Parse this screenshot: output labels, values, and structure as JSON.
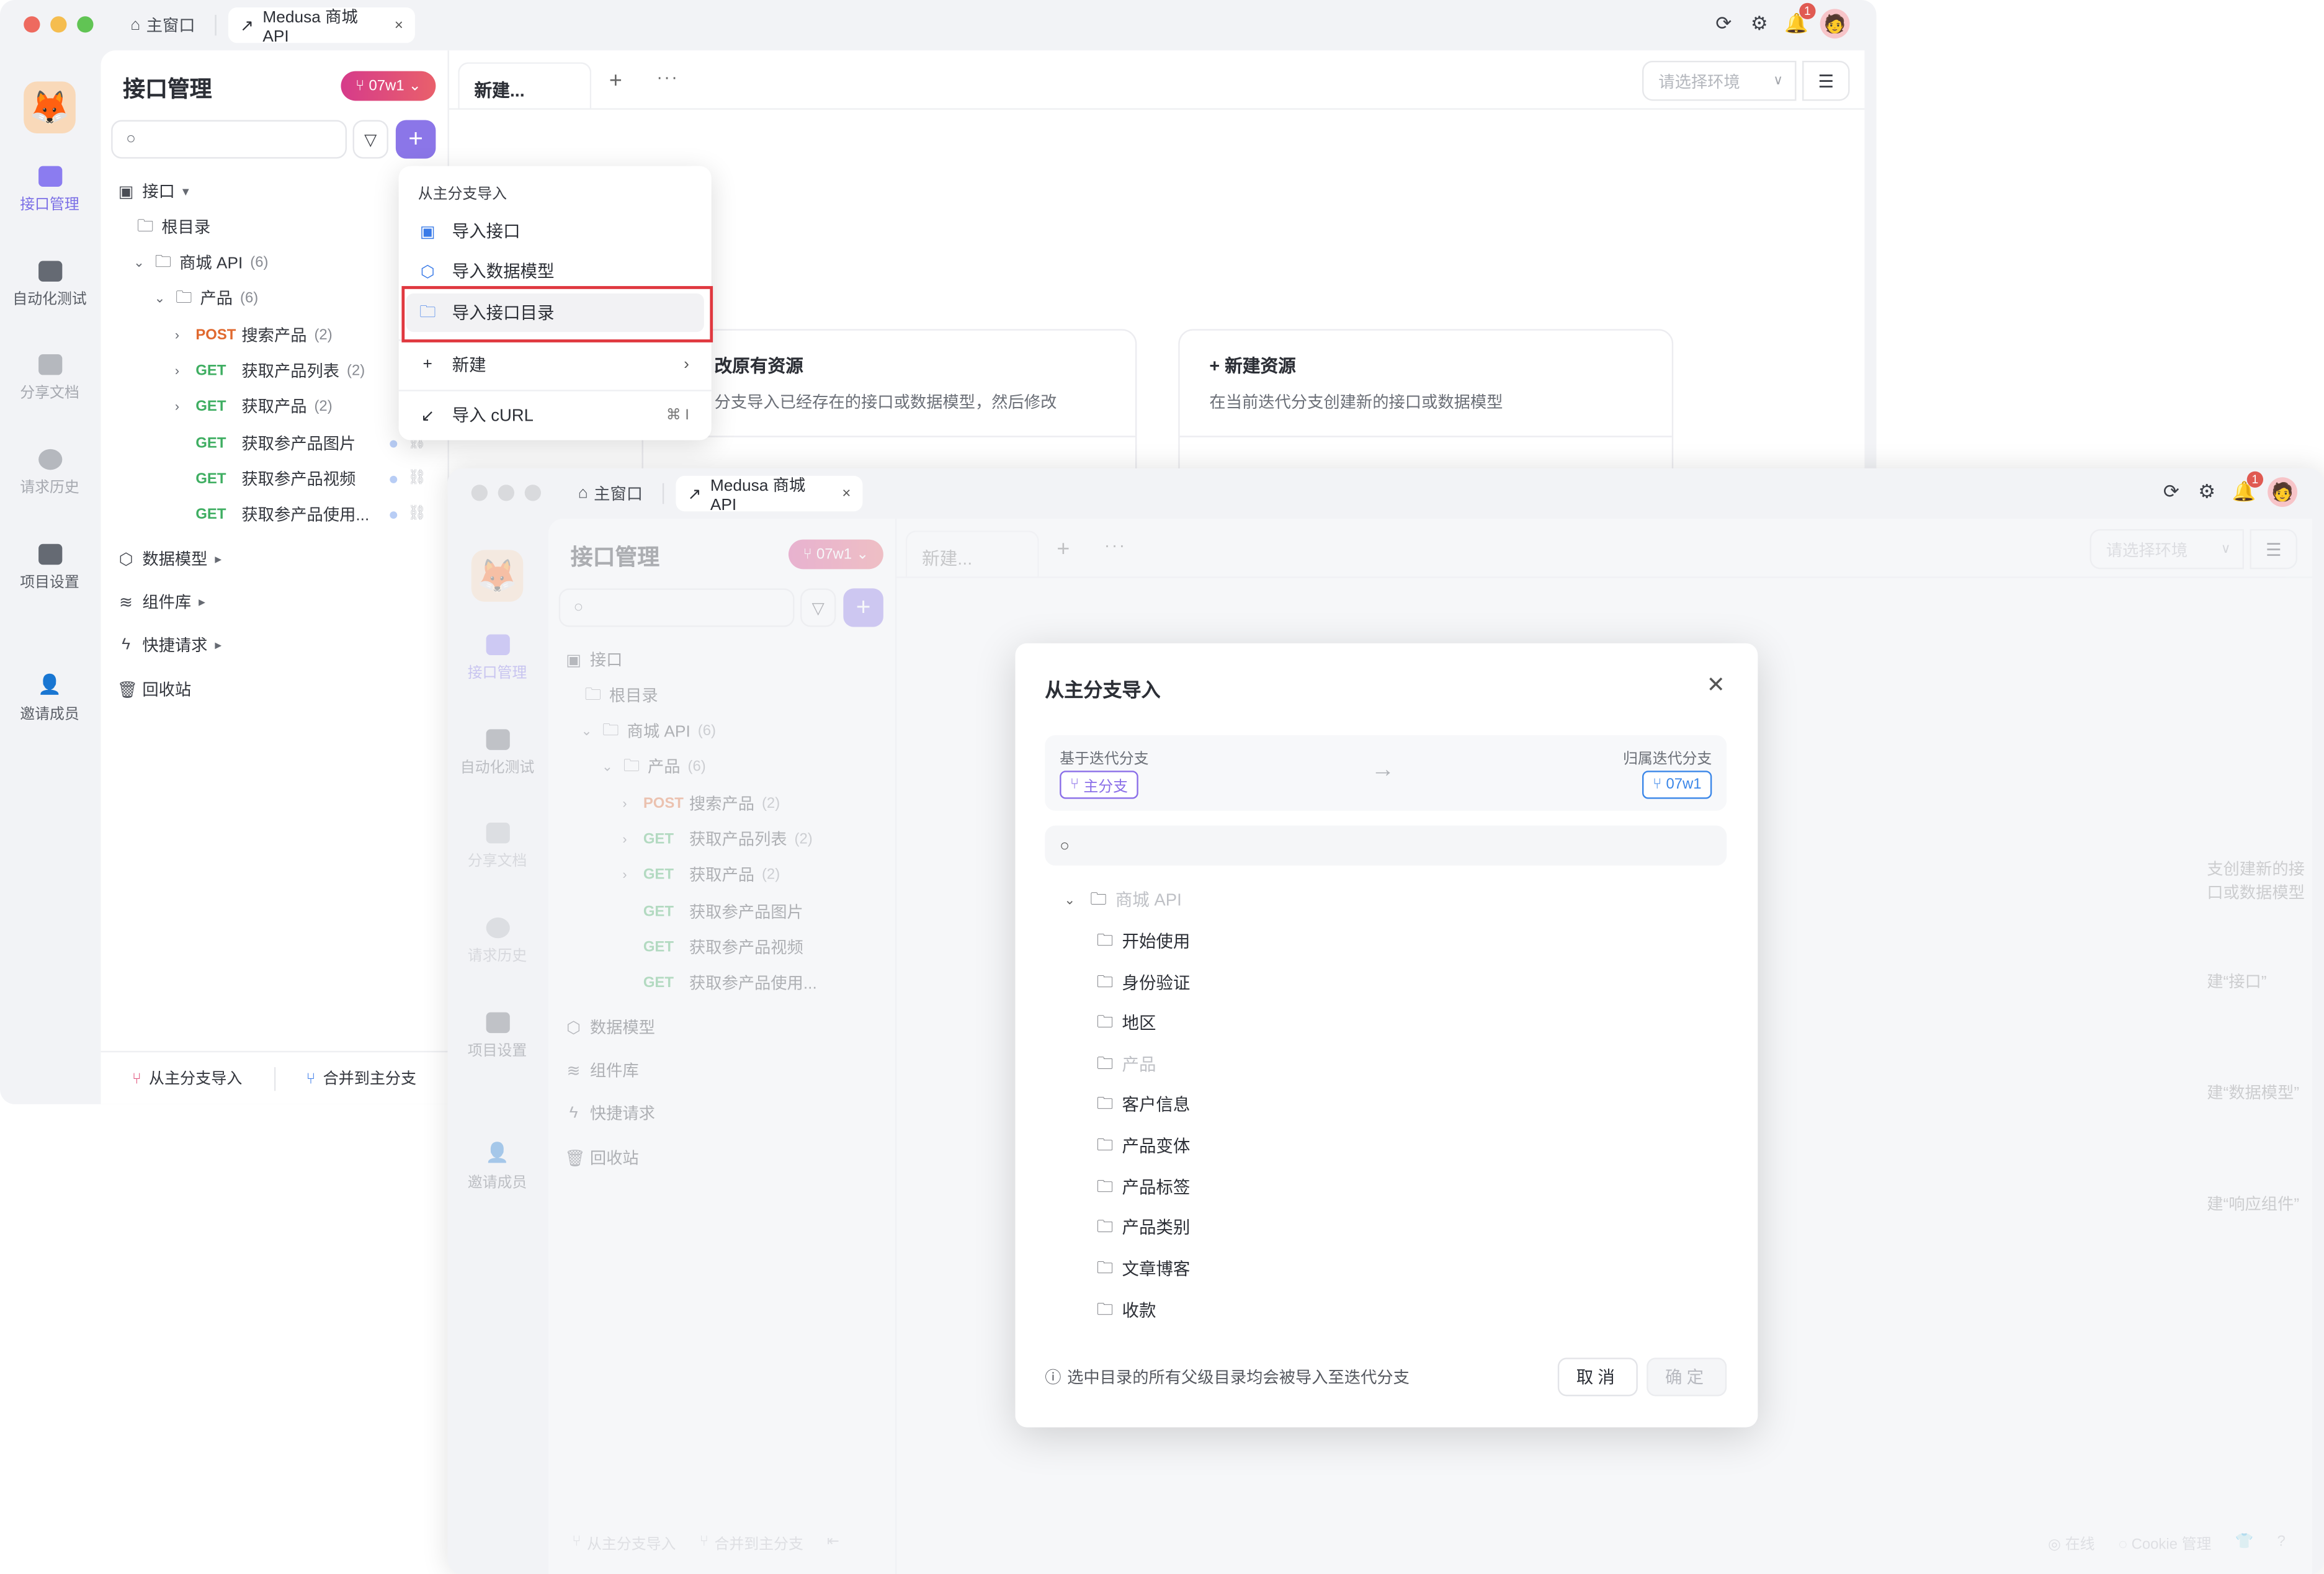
{
  "window": {
    "traffic_lights": [
      "#ee6a5f",
      "#f5bd4f",
      "#61c454"
    ],
    "tabs": [
      {
        "label": "主窗口",
        "icon": "home-icon"
      },
      {
        "label": "Medusa 商城 API",
        "icon": "external-link-icon",
        "close": "×"
      }
    ],
    "notification_count": "1"
  },
  "nav": {
    "items": [
      {
        "label": "接口管理",
        "icon": "api-icon",
        "state": "active"
      },
      {
        "label": "自动化测试",
        "icon": "automation-icon",
        "state": "normal"
      },
      {
        "label": "分享文档",
        "icon": "share-doc-icon",
        "state": "disabled"
      },
      {
        "label": "请求历史",
        "icon": "history-icon",
        "state": "disabled"
      },
      {
        "label": "项目设置",
        "icon": "settings-icon",
        "state": "normal"
      },
      {
        "label": "邀请成员",
        "icon": "invite-user-icon",
        "state": "normal"
      }
    ]
  },
  "sidepanel": {
    "title": "接口管理",
    "branch": "07w1",
    "search_placeholder": "",
    "tree": {
      "section_api": "接口",
      "root": "根目录",
      "folder_shop": "商城 API",
      "folder_shop_count": "(6)",
      "folder_product": "产品",
      "folder_product_count": "(6)",
      "endpoints": [
        {
          "method": "POST",
          "name": "搜索产品",
          "count": "(2)",
          "expandable": true
        },
        {
          "method": "GET",
          "name": "获取产品列表",
          "count": "(2)",
          "expandable": true
        },
        {
          "method": "GET",
          "name": "获取产品",
          "count": "(2)",
          "expandable": true
        },
        {
          "method": "GET",
          "name": "获取参产品图片",
          "count": "",
          "expandable": false
        },
        {
          "method": "GET",
          "name": "获取参产品视频",
          "count": "",
          "expandable": false
        },
        {
          "method": "GET",
          "name": "获取参产品使用...",
          "count": "",
          "expandable": false
        }
      ],
      "sections": [
        "数据模型",
        "组件库",
        "快捷请求",
        "回收站"
      ]
    },
    "footer": {
      "import_label": "从主分支导入",
      "merge_label": "合并到主分支"
    }
  },
  "main": {
    "tab_label": "新建...",
    "env_placeholder": "请选择环境",
    "cards": [
      {
        "title": "改原有资源",
        "desc": "分支导入已经存在的接口或数据模型，然后修改"
      },
      {
        "title": "+ 新建资源",
        "desc": "在当前迭代分支创建新的接口或数据模型"
      }
    ],
    "faded_items": [
      "支创建新的接口或数据模型",
      "建“接口”",
      "建“数据模型”",
      "建“响应组件”"
    ]
  },
  "dropdown": {
    "header": "从主分支导入",
    "items": [
      {
        "label": "导入接口",
        "icon": "api-icon"
      },
      {
        "label": "导入数据模型",
        "icon": "cube-icon"
      },
      {
        "label": "导入接口目录",
        "icon": "folder-icon",
        "highlighted": true
      },
      {
        "label": "新建",
        "icon": "plus-icon",
        "submenu": true
      },
      {
        "label": "导入 cURL",
        "icon": "import-curl-icon",
        "shortcut": "⌘ I"
      }
    ]
  },
  "modal": {
    "title": "从主分支导入",
    "source_label": "基于迭代分支",
    "source_branch": "主分支",
    "target_label": "归属迭代分支",
    "target_branch": "07w1",
    "search_placeholder": "",
    "root_folder": "商城 API",
    "folders": [
      {
        "label": "开始使用",
        "disabled": false
      },
      {
        "label": "身份验证",
        "disabled": false
      },
      {
        "label": "地区",
        "disabled": false
      },
      {
        "label": "产品",
        "disabled": true
      },
      {
        "label": "客户信息",
        "disabled": false
      },
      {
        "label": "产品变体",
        "disabled": false
      },
      {
        "label": "产品标签",
        "disabled": false
      },
      {
        "label": "产品类别",
        "disabled": false
      },
      {
        "label": "文章博客",
        "disabled": false
      },
      {
        "label": "收款",
        "disabled": false
      }
    ],
    "hint": "选中目录的所有父级目录均会被导入至迭代分支",
    "cancel_label": "取消",
    "confirm_label": "确定"
  },
  "statusbar": {
    "online": "在线",
    "cookie": "Cookie 管理"
  }
}
